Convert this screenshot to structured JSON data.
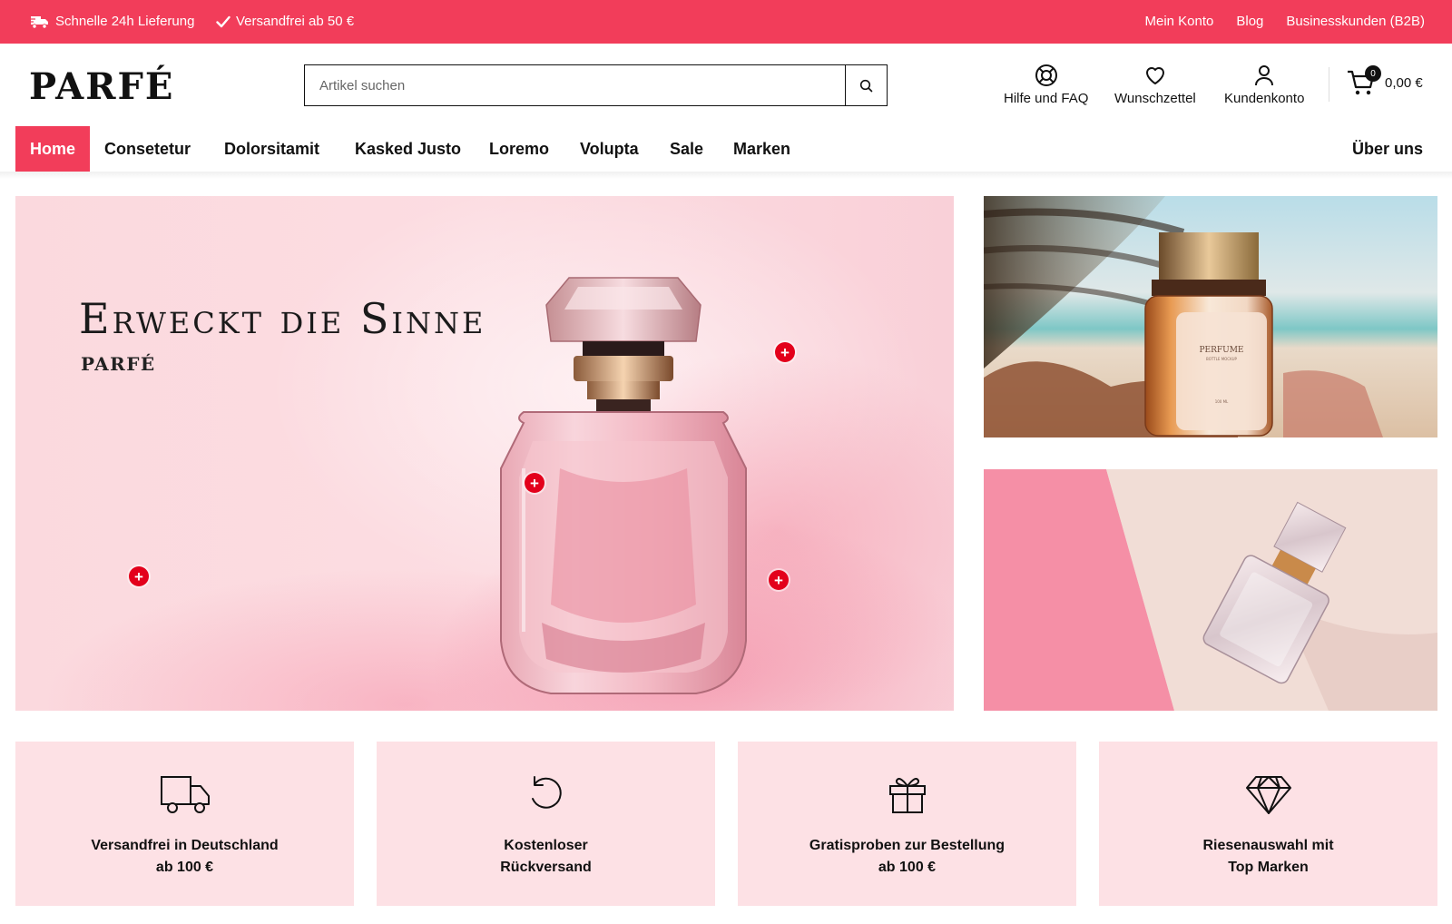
{
  "topbar": {
    "usp_delivery": "Schnelle 24h Lieferung",
    "usp_shipping": "Versandfrei ab 50 €",
    "links": [
      "Mein Konto",
      "Blog",
      "Businesskunden (B2B)"
    ]
  },
  "header": {
    "logo": "PARFÉ",
    "search_placeholder": "Artikel suchen",
    "help_label": "Hilfe und FAQ",
    "wishlist_label": "Wunschzettel",
    "account_label": "Kundenkonto",
    "cart_count": "0",
    "cart_total": "0,00 €",
    "icons": [
      "truck-icon",
      "check-icon",
      "search-icon",
      "lifebuoy-icon",
      "heart-icon",
      "user-icon",
      "cart-icon"
    ]
  },
  "nav": {
    "items": [
      "Home",
      "Consetetur",
      "Dolorsitamit",
      "Kasked Justo",
      "Loremo",
      "Volupta",
      "Sale",
      "Marken"
    ],
    "right_item": "Über uns",
    "active": "Home"
  },
  "hero": {
    "headline": "Erweckt die Sinne",
    "brand": "PARFÉ",
    "hotspot_symbol": "+"
  },
  "banners": {
    "bottle_label": "PERFUME",
    "bottle_sub": "BOTTLE MOCKUP",
    "bottle_volume": "100 ML"
  },
  "features": [
    {
      "icon": "truck-icon",
      "line1": "Versandfrei in Deutschland",
      "line2": "ab 100 €"
    },
    {
      "icon": "return-icon",
      "line1": "Kostenloser",
      "line2": "Rückversand"
    },
    {
      "icon": "gift-icon",
      "line1": "Gratisproben zur Bestellung",
      "line2": "ab 100 €"
    },
    {
      "icon": "diamond-icon",
      "line1": "Riesenauswahl mit",
      "line2": "Top Marken"
    }
  ],
  "colors": {
    "accent": "#f23d5a",
    "feature_bg": "#fde1e5",
    "hotspot": "#e3001b"
  }
}
